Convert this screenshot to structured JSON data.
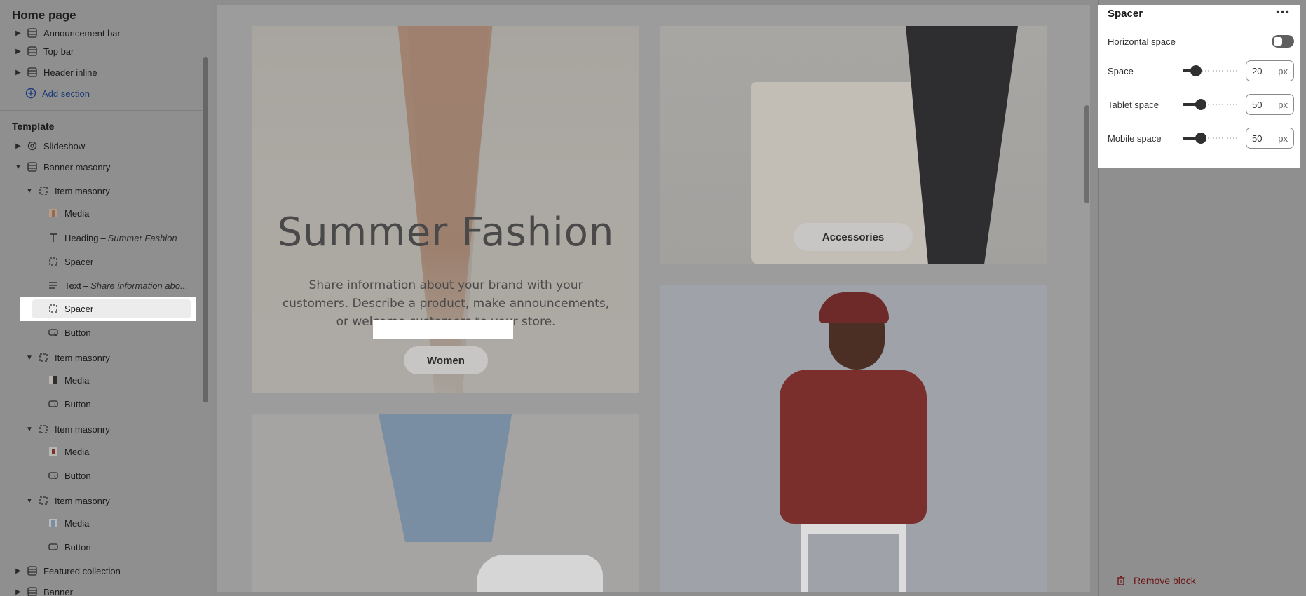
{
  "sidebar": {
    "title": "Home page",
    "header_items": [
      {
        "label": "Top bar"
      },
      {
        "label": "Header inline"
      }
    ],
    "partial_label": "Announcement bar",
    "add_section": "Add section",
    "template_label": "Template",
    "tree": [
      {
        "label": "Slideshow"
      },
      {
        "label": "Banner masonry"
      },
      {
        "label": "Item masonry"
      },
      {
        "label": "Media"
      },
      {
        "label": "Heading",
        "sub": "Summer Fashion"
      },
      {
        "label": "Spacer"
      },
      {
        "label": "Text",
        "sub": "Share information abo..."
      },
      {
        "label": "Spacer"
      },
      {
        "label": "Button"
      },
      {
        "label": "Item masonry"
      },
      {
        "label": "Media"
      },
      {
        "label": "Button"
      },
      {
        "label": "Item masonry"
      },
      {
        "label": "Media"
      },
      {
        "label": "Button"
      },
      {
        "label": "Item masonry"
      },
      {
        "label": "Media"
      },
      {
        "label": "Button"
      },
      {
        "label": "Featured collection"
      },
      {
        "label": "Banner"
      }
    ],
    "dash": "–"
  },
  "preview": {
    "hero_title": "Summer Fashion",
    "hero_text": "Share information about your brand with your customers. Describe a product, make announcements, or welcome customers to your store.",
    "women_button": "Women",
    "accessories_button": "Accessories"
  },
  "settings": {
    "title": "Spacer",
    "more_icon": "•••",
    "horizontal_space_label": "Horizontal space",
    "horizontal_space_on": false,
    "space_label": "Space",
    "space_value": "20",
    "tablet_space_label": "Tablet space",
    "tablet_space_value": "50",
    "mobile_space_label": "Mobile space",
    "mobile_space_value": "50",
    "unit": "px",
    "space_fraction": 0.16,
    "tablet_fraction": 0.28,
    "mobile_fraction": 0.28,
    "remove_label": "Remove block"
  },
  "colors": {
    "accent_danger": "#6b1414",
    "link": "#1a3a7a"
  }
}
